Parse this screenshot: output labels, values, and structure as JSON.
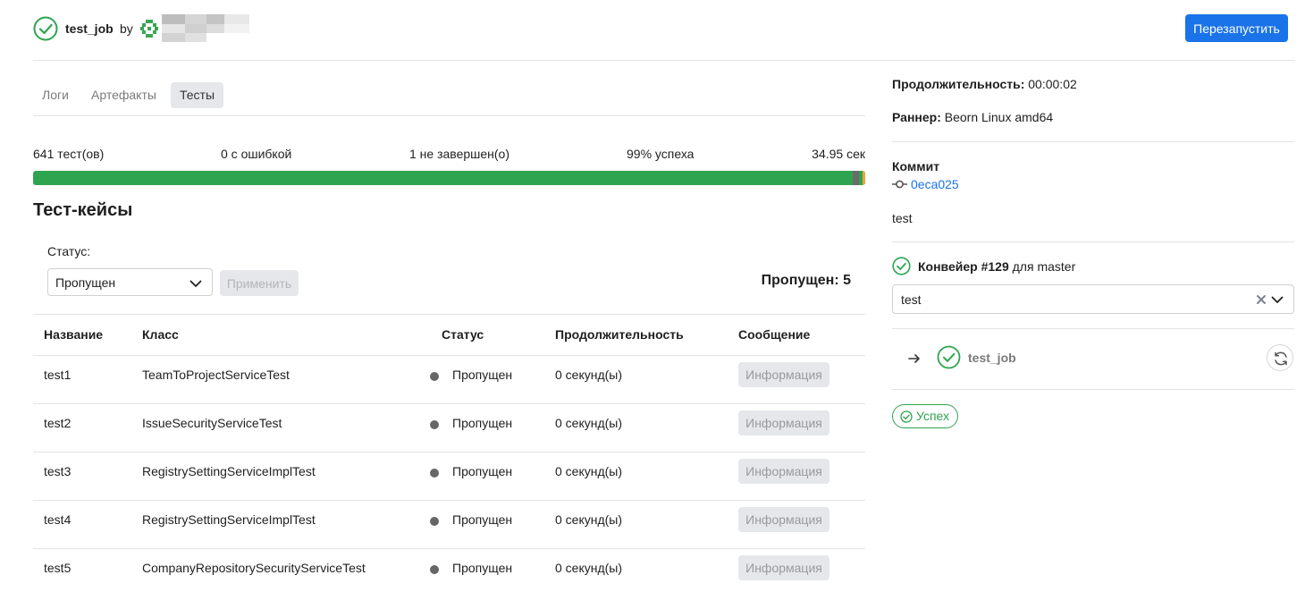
{
  "header": {
    "job_name": "test_job",
    "by_label": "by",
    "restart_label": "Перезапустить"
  },
  "tabs": [
    {
      "label": "Логи",
      "active": false
    },
    {
      "label": "Артефакты",
      "active": false
    },
    {
      "label": "Тесты",
      "active": true
    }
  ],
  "summary": {
    "total": "641 тест(ов)",
    "errors": "0 с ошибкой",
    "unfinished": "1 не завершен(о)",
    "success_rate": "99% успеха",
    "duration": "34.95 сек",
    "progress": {
      "passed_fraction": 0.992,
      "unfinished_fraction": 0.008,
      "colors": {
        "passed": "#2ea44f",
        "skipped": "#6b6b6b",
        "unfinished": "#f2a33a"
      }
    }
  },
  "test_cases": {
    "title": "Тест-кейсы",
    "status_label": "Статус:",
    "status_value": "Пропущен",
    "apply_label": "Применить",
    "skipped_count": "Пропущен: 5",
    "columns": [
      "Название",
      "Класс",
      "Статус",
      "Продолжительность",
      "Сообщение"
    ],
    "info_label": "Информация",
    "rows": [
      {
        "name": "test1",
        "class": "TeamToProjectServiceTest",
        "status": "Пропущен",
        "duration": "0 секунд(ы)"
      },
      {
        "name": "test2",
        "class": "IssueSecurityServiceTest",
        "status": "Пропущен",
        "duration": "0 секунд(ы)"
      },
      {
        "name": "test3",
        "class": "RegistrySettingServiceImplTest",
        "status": "Пропущен",
        "duration": "0 секунд(ы)"
      },
      {
        "name": "test4",
        "class": "RegistrySettingServiceImplTest",
        "status": "Пропущен",
        "duration": "0 секунд(ы)"
      },
      {
        "name": "test5",
        "class": "CompanyRepositorySecurityServiceTest",
        "status": "Пропущен",
        "duration": "0 секунд(ы)"
      }
    ]
  },
  "sidebar": {
    "duration_label": "Продолжительность:",
    "duration_value": "00:00:02",
    "runner_label": "Раннер:",
    "runner_value": "Beorn Linux amd64",
    "commit_label": "Коммит",
    "commit_hash": "0eca025",
    "commit_message": "test",
    "pipeline_link": "Конвейер #129",
    "pipeline_suffix": "для master",
    "stage_value": "test",
    "job_name": "test_job",
    "status_badge": "Успех"
  },
  "colors": {
    "accent": "#1a73e8",
    "success": "#2ea44f",
    "border": "#e3e3e3",
    "muted": "#7a7a7a"
  },
  "icons": [
    "check-circle-icon",
    "avatar-icon",
    "commit-icon",
    "close-icon",
    "chevron-down-icon",
    "arrow-right-icon",
    "retry-icon"
  ]
}
